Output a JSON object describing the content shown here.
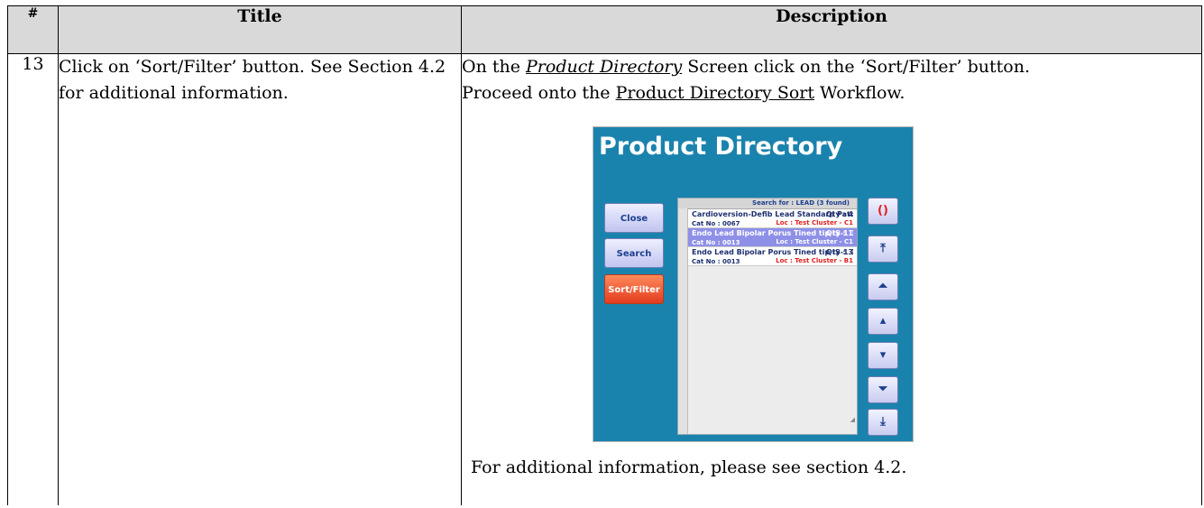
{
  "table": {
    "headers": {
      "num": "#",
      "title": "Title",
      "description": "Description"
    },
    "row": {
      "num": "13",
      "title": "Click on ‘Sort/Filter’ button.  See Section 4.2 for additional information.",
      "desc_p1_pre": "On the ",
      "desc_p1_link": "Product Directory",
      "desc_p1_post": " Screen click on the ‘Sort/Filter’ button.",
      "desc_p2_pre": "Proceed onto the ",
      "desc_p2_link": "Product Directory Sort",
      "desc_p2_post": " Workflow.",
      "desc_footer": "For additional information, please see section 4.2."
    }
  },
  "app": {
    "title": "Product Directory",
    "buttons": {
      "close": "Close",
      "search": "Search",
      "sort": "Sort/Filter"
    },
    "list_header": "Search for : LEAD (3 found)",
    "items": [
      {
        "name": "Cardioversion-Defib Lead Standard Patch",
        "qty": "Qty : 4",
        "cat": "Cat No : 0067",
        "loc": "Loc : Test Cluster -  C1"
      },
      {
        "name": "Endo Lead Bipolar Porus Tined tip IS-1 100CM",
        "qty": "Qty : 1",
        "cat": "Cat No : 0013",
        "loc": "Loc : Test Cluster -  C1"
      },
      {
        "name": "Endo Lead Bipolar Porus Tined tip IS-1 100CM",
        "qty": "Qty : 3",
        "cat": "Cat No : 0013",
        "loc": "Loc : Test Cluster -  B1"
      }
    ],
    "nav_icons": [
      "refresh-icon",
      "first-page-icon",
      "page-up-icon",
      "up-icon",
      "down-icon",
      "page-down-icon",
      "last-page-icon"
    ],
    "colors": {
      "background": "#1a83ad",
      "selected_row": "#8e90e8",
      "sort_button": "#e23c1e"
    }
  }
}
